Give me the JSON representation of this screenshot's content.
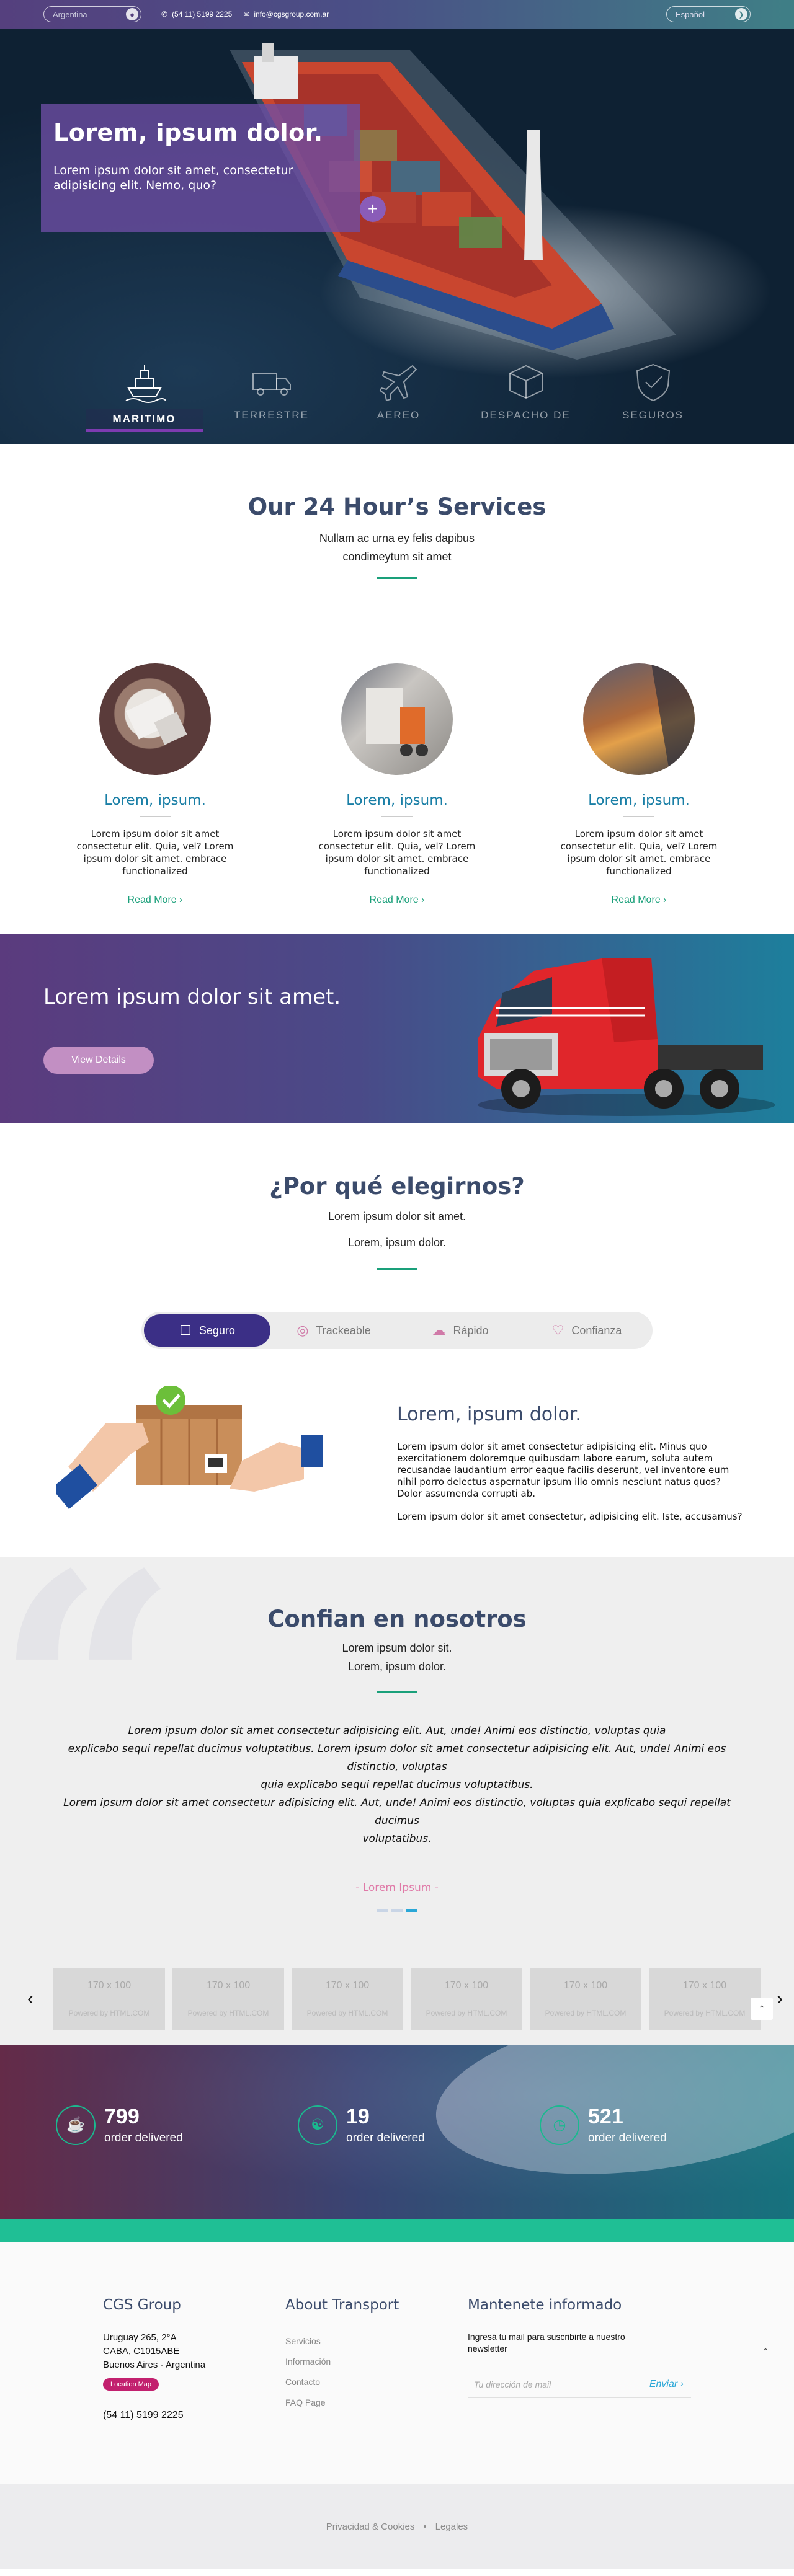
{
  "topbar": {
    "country": "Argentina",
    "phone": "(54 11) 5199 2225",
    "email": "info@cgsgroup.com.ar",
    "language": "Español"
  },
  "hero": {
    "title": "Lorem, ipsum dolor.",
    "text": "Lorem ipsum dolor sit amet, consectetur adipisicing elit. Nemo, quo?",
    "plus": "+",
    "tabs": [
      {
        "label": "MARITIMO",
        "icon": "ship-icon",
        "active": true
      },
      {
        "label": "TERRESTRE",
        "icon": "truck-icon",
        "active": false
      },
      {
        "label": "AEREO",
        "icon": "airplane-icon",
        "active": false
      },
      {
        "label": "DESPACHO DE",
        "icon": "package-icon",
        "active": false
      },
      {
        "label": "SEGUROS",
        "icon": "shield-check-icon",
        "active": false
      }
    ]
  },
  "services": {
    "title": "Our 24 Hour’s Services",
    "subtitle_1": "Nullam ac urna ey felis dapibus",
    "subtitle_2": "condimeytum sit amet",
    "cards": [
      {
        "title": "Lorem, ipsum.",
        "text": "Lorem ipsum dolor sit amet consectetur elit. Quia, vel? Lorem ipsum dolor sit amet. embrace functionalized",
        "link": "Read More"
      },
      {
        "title": "Lorem, ipsum.",
        "text": "Lorem ipsum dolor sit amet consectetur elit. Quia, vel? Lorem ipsum dolor sit amet. embrace functionalized",
        "link": "Read More"
      },
      {
        "title": "Lorem, ipsum.",
        "text": "Lorem ipsum dolor sit amet consectetur elit. Quia, vel? Lorem ipsum dolor sit amet. embrace functionalized",
        "link": "Read More"
      }
    ]
  },
  "banner": {
    "title": "Lorem ipsum dolor sit amet.",
    "button": "View Details"
  },
  "why": {
    "title": "¿Por qué elegirnos?",
    "subtitle_1": "Lorem ipsum dolor sit amet.",
    "subtitle_2": "Lorem, ipsum dolor.",
    "tabs": [
      {
        "label": "Seguro",
        "icon": "hand-box-icon",
        "active": true
      },
      {
        "label": "Trackeable",
        "icon": "tracking-icon",
        "active": false
      },
      {
        "label": "Rápido",
        "icon": "fast-delivery-icon",
        "active": false
      },
      {
        "label": "Confianza",
        "icon": "handshake-icon",
        "active": false
      }
    ],
    "content_title": "Lorem, ipsum dolor.",
    "content_p1": "Lorem ipsum dolor sit amet consectetur adipisicing elit. Minus quo exercitationem doloremque quibusdam labore earum, soluta autem recusandae laudantium error eaque facilis deserunt, vel inventore eum nihil porro delectus aspernatur ipsum illo omnis nesciunt natus quos? Dolor assumenda corrupti ab.",
    "content_p2": "Lorem ipsum dolor sit amet consectetur, adipisicing elit. Iste, accusamus?"
  },
  "trust": {
    "title": "Confian en nosotros",
    "subtitle_1": "Lorem ipsum dolor sit.",
    "subtitle_2": "Lorem, ipsum dolor.",
    "quote_1": "Lorem ipsum dolor sit amet consectetur adipisicing elit. Aut, unde! Animi eos distinctio, voluptas quia",
    "quote_2": "explicabo sequi repellat ducimus voluptatibus. Lorem ipsum dolor sit amet consectetur adipisicing elit. Aut, unde! Animi eos distinctio, voluptas",
    "quote_3": "quia explicabo sequi repellat ducimus voluptatibus.",
    "quote_4": "Lorem ipsum dolor sit amet consectetur adipisicing elit. Aut, unde! Animi eos distinctio, voluptas quia explicabo sequi repellat ducimus",
    "quote_5": "voluptatibus.",
    "author": "- Lorem Ipsum -",
    "logo_size": "170 x 100",
    "logo_powered": "Powered by HTML.COM"
  },
  "stats": [
    {
      "value": "799",
      "label": "order delivered",
      "icon": "box-hand-icon"
    },
    {
      "value": "19",
      "label": "order delivered",
      "icon": "globe-hand-icon"
    },
    {
      "value": "521",
      "label": "order delivered",
      "icon": "clock-icon"
    }
  ],
  "footer": {
    "company": "CGS Group",
    "address_1": "Uruguay 265, 2°A",
    "address_2": "CABA, C1015ABE",
    "address_3": "Buenos Aires - Argentina",
    "map_button": "Location Map",
    "phone": "(54 11) 5199 2225",
    "about_title": "About Transport",
    "links": [
      "Servicios",
      "Información",
      "Contacto",
      "FAQ Page"
    ],
    "newsletter_title": "Mantenete informado",
    "newsletter_text": "Ingresá tu mail para suscribirte a nuestro newsletter",
    "email_placeholder": "Tu dirección de mail",
    "send": "Enviar"
  },
  "legal": {
    "privacy": "Privacidad & Cookies",
    "sep": "•",
    "legal": "Legales"
  }
}
